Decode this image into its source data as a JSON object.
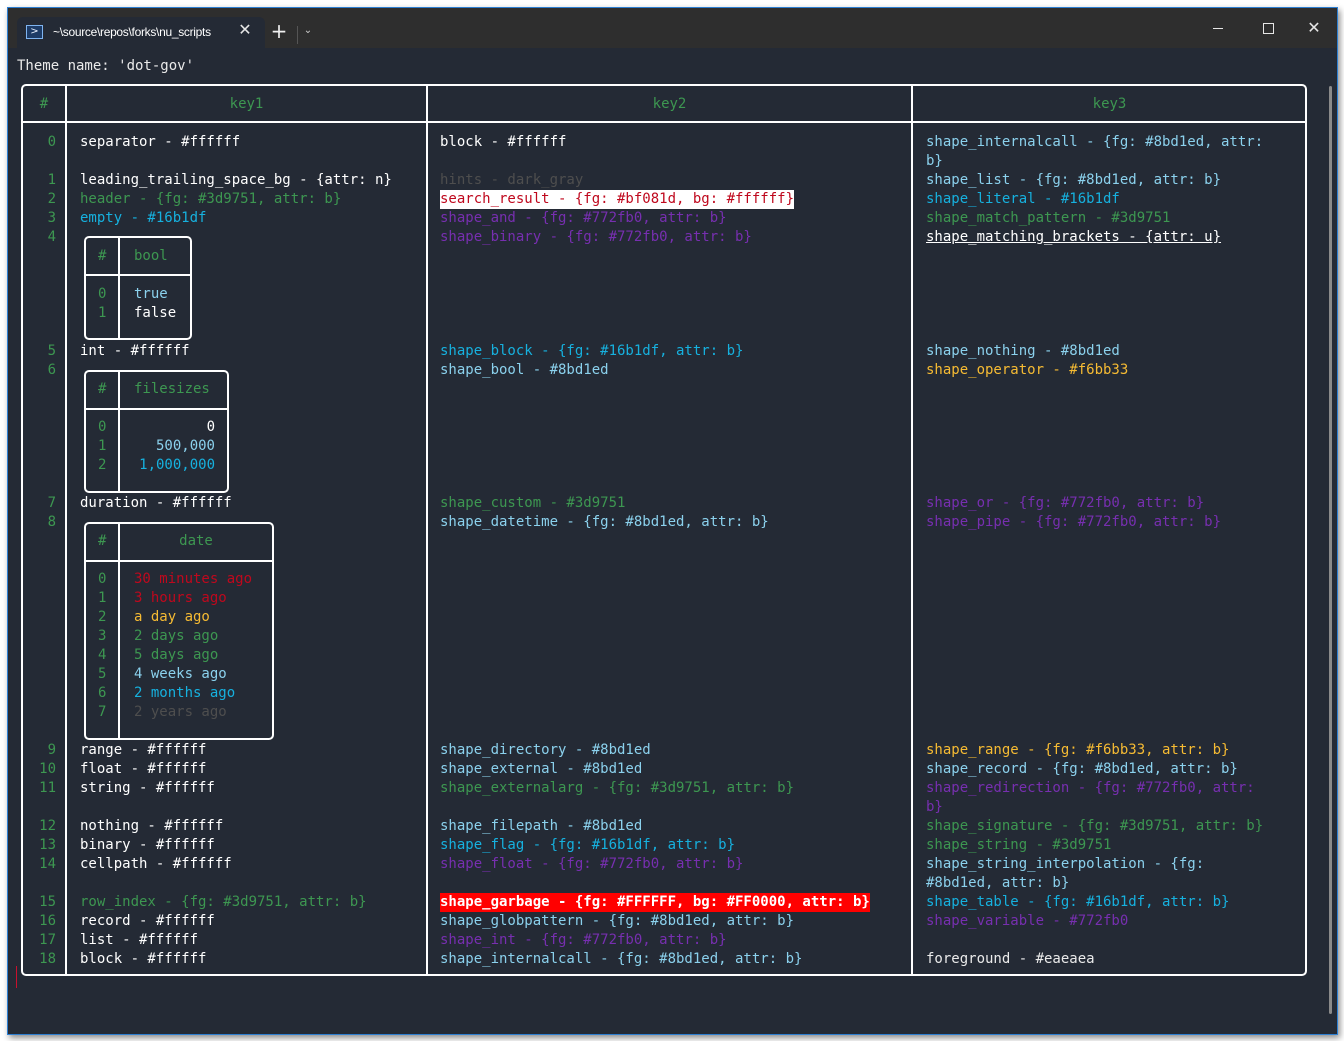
{
  "window": {
    "tab_title": "~\\source\\repos\\forks\\nu_scripts",
    "tab_icon": "powershell-icon",
    "close_tab_glyph": "✕",
    "new_tab_glyph": "+",
    "dropdown_glyph": "⌄",
    "close_glyph": "✕"
  },
  "theme_line": "Theme name: 'dot-gov'",
  "table": {
    "headers": {
      "index": "#",
      "key1": "key1",
      "key2": "key2",
      "key3": "key3"
    },
    "indices": [
      "0",
      "1",
      "2",
      "3",
      "4",
      "5",
      "6",
      "7",
      "8",
      "9",
      "10",
      "11",
      "12",
      "13",
      "14",
      "15",
      "16",
      "17",
      "18"
    ],
    "key1": {
      "separator": "separator - #ffffff",
      "leading_trailing_space_bg": "leading_trailing_space_bg - {attr: n}",
      "header": "header - {fg: #3d9751, attr: b}",
      "empty": "empty - #16b1df",
      "bool_table": {
        "idx_header": "#",
        "col_header": "bool",
        "rows": [
          {
            "i": "0",
            "v": "true"
          },
          {
            "i": "1",
            "v": "false"
          }
        ]
      },
      "int": "int - #ffffff",
      "filesizes_table": {
        "idx_header": "#",
        "col_header": "filesizes",
        "rows": [
          {
            "i": "0",
            "v": "0"
          },
          {
            "i": "1",
            "v": "500,000"
          },
          {
            "i": "2",
            "v": "1,000,000"
          }
        ]
      },
      "duration": "duration - #ffffff",
      "date_table": {
        "idx_header": "#",
        "col_header": "date",
        "rows": [
          {
            "i": "0",
            "v": "30 minutes ago"
          },
          {
            "i": "1",
            "v": "3 hours ago"
          },
          {
            "i": "2",
            "v": "a day ago"
          },
          {
            "i": "3",
            "v": "2 days ago"
          },
          {
            "i": "4",
            "v": "5 days ago"
          },
          {
            "i": "5",
            "v": "4 weeks ago"
          },
          {
            "i": "6",
            "v": "2 months ago"
          },
          {
            "i": "7",
            "v": "2 years ago"
          }
        ]
      },
      "range": "range - #ffffff",
      "float": "float - #ffffff",
      "string": "string - #ffffff",
      "nothing": "nothing - #ffffff",
      "binary": "binary - #ffffff",
      "cellpath": "cellpath - #ffffff",
      "row_index": "row_index - {fg: #3d9751, attr: b}",
      "record": "record - #ffffff",
      "list": "list - #ffffff",
      "block": "block - #ffffff"
    },
    "key2": {
      "block": "block - #ffffff",
      "hints": "hints - dark_gray",
      "search_result": "search_result - {fg: #bf081d, bg: #ffffff}",
      "shape_and": "shape_and - {fg: #772fb0, attr: b}",
      "shape_binary": "shape_binary - {fg: #772fb0, attr: b}",
      "shape_block": "shape_block - {fg: #16b1df, attr: b}",
      "shape_bool": "shape_bool - #8bd1ed",
      "shape_custom": "shape_custom - #3d9751",
      "shape_datetime": "shape_datetime - {fg: #8bd1ed, attr: b}",
      "shape_directory": "shape_directory - #8bd1ed",
      "shape_external": "shape_external - #8bd1ed",
      "shape_externalarg": "shape_externalarg - {fg: #3d9751, attr: b}",
      "shape_filepath": "shape_filepath - #8bd1ed",
      "shape_flag": "shape_flag - {fg: #16b1df, attr: b}",
      "shape_float": "shape_float - {fg: #772fb0, attr: b}",
      "shape_garbage": "shape_garbage - {fg: #FFFFFF, bg: #FF0000, attr: b}",
      "shape_globpattern": "shape_globpattern - {fg: #8bd1ed, attr: b}",
      "shape_int": "shape_int - {fg: #772fb0, attr: b}",
      "shape_internalcall": "shape_internalcall - {fg: #8bd1ed, attr: b}"
    },
    "key3": {
      "shape_internalcall_1": "shape_internalcall - {fg: #8bd1ed, attr:",
      "shape_internalcall_2": "b}",
      "shape_list": "shape_list - {fg: #8bd1ed, attr: b}",
      "shape_literal": "shape_literal - #16b1df",
      "shape_match_pattern": "shape_match_pattern - #3d9751",
      "shape_matching_brackets": "shape_matching_brackets - {attr: u}",
      "shape_nothing": "shape_nothing - #8bd1ed",
      "shape_operator": "shape_operator - #f6bb33",
      "shape_or": "shape_or - {fg: #772fb0, attr: b}",
      "shape_pipe": "shape_pipe - {fg: #772fb0, attr: b}",
      "shape_range": "shape_range - {fg: #f6bb33, attr: b}",
      "shape_record": "shape_record - {fg: #8bd1ed, attr: b}",
      "shape_redirection_1": "shape_redirection - {fg: #772fb0, attr:",
      "shape_redirection_2": "b}",
      "shape_signature": "shape_signature - {fg: #3d9751, attr: b}",
      "shape_string": "shape_string - #3d9751",
      "shape_string_interpolation_1": "shape_string_interpolation - {fg:",
      "shape_string_interpolation_2": "#8bd1ed, attr: b}",
      "shape_table": "shape_table - {fg: #16b1df, attr: b}",
      "shape_variable": "shape_variable - #772fb0",
      "foreground": "foreground - #eaeaea"
    }
  },
  "colors": {
    "background": "#242a35",
    "green": "#3d9751",
    "cyan": "#16b1df",
    "light_blue": "#8bd1ed",
    "purple": "#772fb0",
    "orange": "#f6bb33",
    "red": "#bf081d",
    "foreground": "#eaeaea"
  }
}
